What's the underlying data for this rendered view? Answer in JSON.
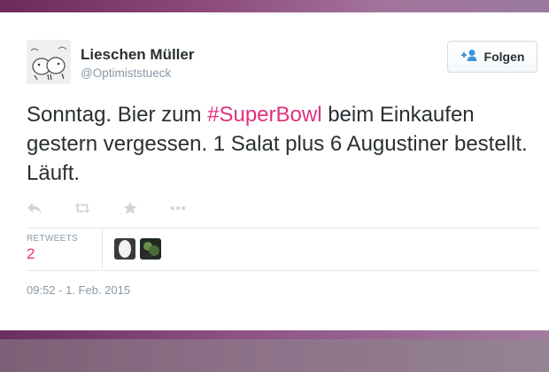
{
  "user": {
    "name": "Lieschen Müller",
    "handle": "@Optimiststueck"
  },
  "follow_button": {
    "label": "Folgen",
    "icon": "add-user-icon"
  },
  "tweet": {
    "text_before": "Sonntag. Bier zum ",
    "hashtag": "#SuperBowl",
    "text_after": " beim Einkaufen gestern vergessen. 1 Salat plus 6 Augustiner bestellt. Läuft."
  },
  "actions": [
    "reply-icon",
    "retweet-icon",
    "favorite-icon",
    "more-icon"
  ],
  "stats": {
    "retweets_label": "RETWEETS",
    "retweets_count": "2"
  },
  "timestamp": "09:52 - 1. Feb. 2015",
  "colors": {
    "accent": "#e0317f",
    "frame": "#7a3a6d",
    "text": "#292f33",
    "muted": "#8899a6"
  }
}
